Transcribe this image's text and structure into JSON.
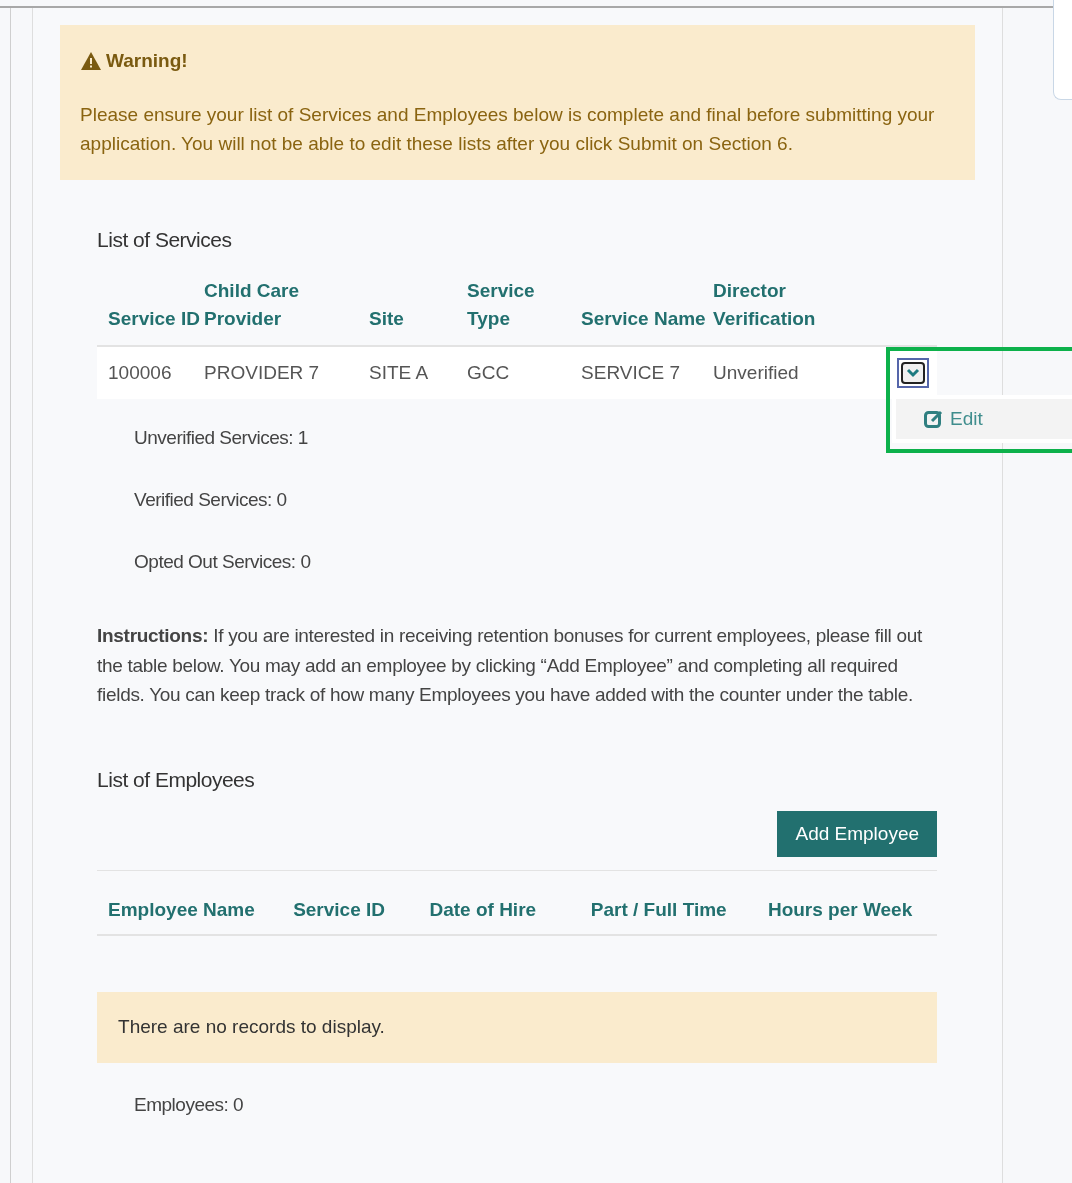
{
  "warning": {
    "title": "Warning!",
    "text": "Please ensure your list of Services and Employees below is complete and final before submitting your application. You will not be able to edit these lists after you click Submit on Section 6."
  },
  "services": {
    "title": "List of Services",
    "columns": [
      "Service ID",
      "Child Care Provider",
      "Site",
      "Service Type",
      "Service Name",
      "Director Verification"
    ],
    "rows": [
      {
        "cells": [
          "100006",
          "PROVIDER 7",
          "SITE A",
          "GCC",
          "SERVICE 7",
          "Unverified"
        ],
        "expanded": true,
        "menu": [
          "Edit"
        ]
      }
    ],
    "counts": [
      "Unverified Services: 1",
      "Verified Services: 0",
      "Opted Out Services: 0"
    ]
  },
  "instructions": "**Instructions:** If you are interested in receiving retention bonuses for current employees, please fill out the table below. You may add an employee by clicking “Add Employee” and completing all required fields. You can keep track of how many Employees you have added with the counter under the table.",
  "employees": {
    "title": "List of Employees",
    "add_button": "Add Employee",
    "columns": [
      "Employee Name",
      "Service ID",
      "Date of Hire",
      "Part / Full Time",
      "Hours per Week"
    ],
    "empty": "There are no records to display.",
    "count": "Employees: 0"
  }
}
